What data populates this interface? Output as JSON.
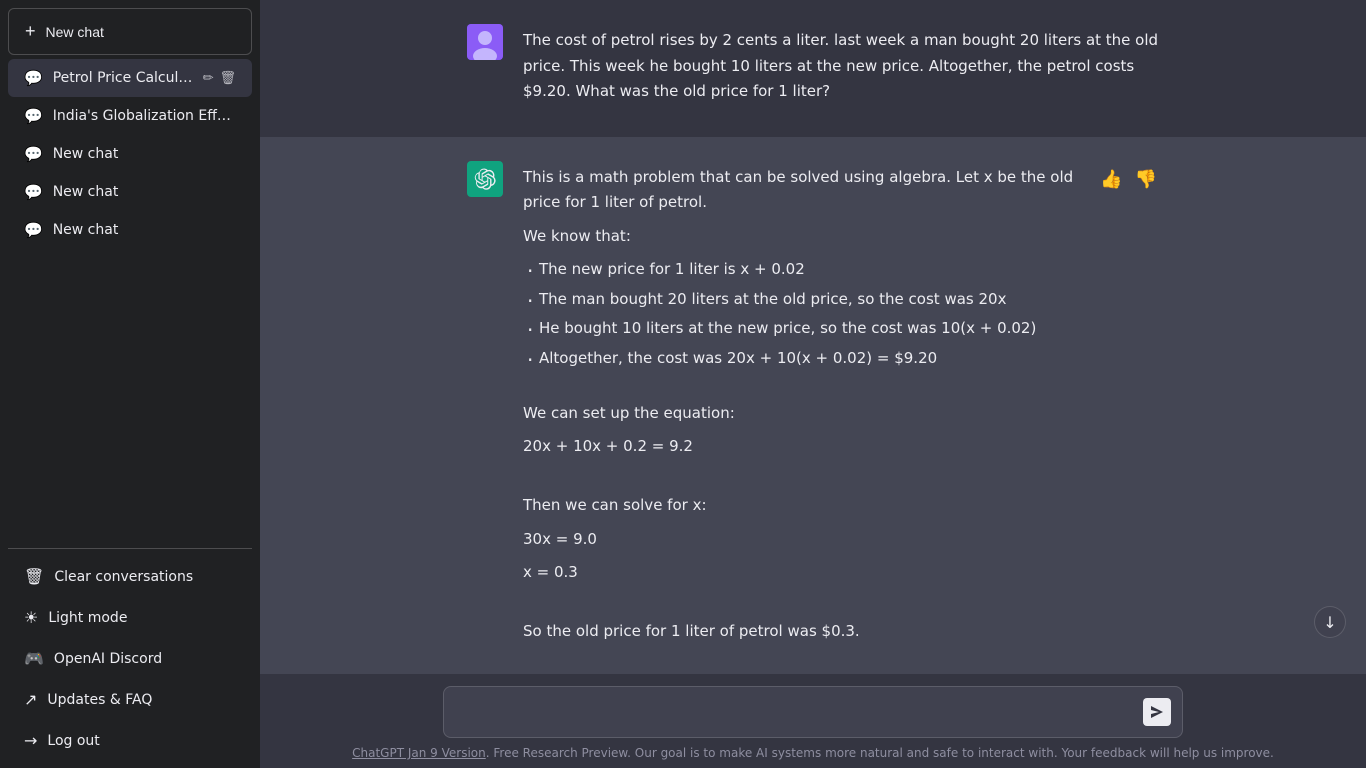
{
  "sidebar": {
    "new_chat_label": "New chat",
    "new_chat_icon": "+",
    "chats": [
      {
        "id": "petrol",
        "label": "Petrol Price Calculation",
        "active": true,
        "show_actions": true
      },
      {
        "id": "india",
        "label": "India's Globalization Efforts",
        "active": false,
        "show_actions": false
      },
      {
        "id": "new1",
        "label": "New chat",
        "active": false,
        "show_actions": false
      },
      {
        "id": "new2",
        "label": "New chat",
        "active": false,
        "show_actions": false
      },
      {
        "id": "new3",
        "label": "New chat",
        "active": false,
        "show_actions": false
      }
    ],
    "footer": [
      {
        "id": "clear",
        "label": "Clear conversations",
        "icon": "🗑"
      },
      {
        "id": "light",
        "label": "Light mode",
        "icon": "☀"
      },
      {
        "id": "discord",
        "label": "OpenAI Discord",
        "icon": "🎮"
      },
      {
        "id": "faq",
        "label": "Updates & FAQ",
        "icon": "↗"
      },
      {
        "id": "logout",
        "label": "Log out",
        "icon": "→"
      }
    ]
  },
  "messages": [
    {
      "id": "user1",
      "role": "user",
      "text": "The cost of petrol rises by 2 cents a liter. last week a man bought 20 liters at the old price. This week he bought 10 liters at the new price. Altogether, the petrol costs $9.20. What was the old price for 1 liter?"
    },
    {
      "id": "assistant1",
      "role": "assistant",
      "intro": "This is a math problem that can be solved using algebra. Let x be the old price for 1 liter of petrol.",
      "we_know": "We know that:",
      "bullets": [
        "The new price for 1 liter is x + 0.02",
        "The man bought 20 liters at the old price, so the cost was 20x",
        "He bought 10 liters at the new price, so the cost was 10(x + 0.02)",
        "Altogether, the cost was 20x + 10(x + 0.02) = $9.20"
      ],
      "equation_intro": "We can set up the equation:",
      "equation": "20x + 10x + 0.2 = 9.2",
      "solve_intro": "Then we can solve for x:",
      "step1": "30x = 9.0",
      "step2": "x = 0.3",
      "conclusion": "So the old price for 1 liter of petrol was $0.3."
    }
  ],
  "input": {
    "placeholder": "",
    "send_icon": "▶"
  },
  "footer": {
    "version_link": "ChatGPT Jan 9 Version",
    "footer_text": ". Free Research Preview. Our goal is to make AI systems more natural and safe to interact with. Your feedback will help us improve."
  }
}
